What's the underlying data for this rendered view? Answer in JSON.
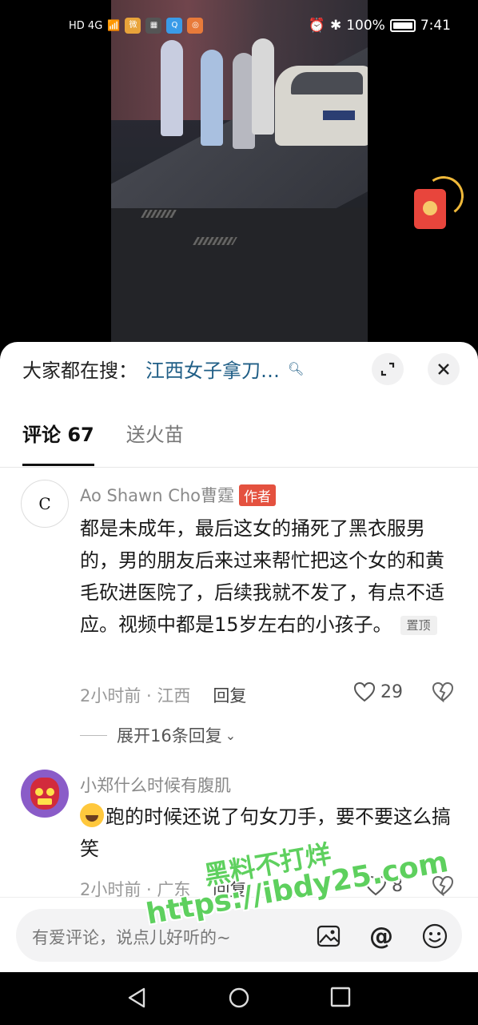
{
  "status_bar": {
    "network": "HD 4G",
    "battery_percent": "100%",
    "time": "7:41"
  },
  "search": {
    "label": "大家都在搜：",
    "query": "江西女子拿刀…"
  },
  "tabs": [
    {
      "label": "评论 67",
      "active": true
    },
    {
      "label": "送火苗",
      "active": false
    }
  ],
  "comments": [
    {
      "username": "Ao Shawn Cho曹霆",
      "badge": "作者",
      "text": "都是未成年，最后这女的捅死了黑衣服男的，男的朋友后来过来帮忙把这个女的和黄毛砍进医院了，后续我就不发了，有点不适应。视频中都是15岁左右的小孩子。",
      "pin": "置顶",
      "meta": "2小时前 · 江西",
      "reply": "回复",
      "likes": "29",
      "expand": "展开16条回复"
    },
    {
      "username": "小郑什么时候有腹肌",
      "text": "跑的时候还说了句女刀手，要不要这么搞笑",
      "meta": "2小时前 · 广东",
      "reply": "回复",
      "likes": "8"
    }
  ],
  "input": {
    "placeholder": "有爱评论，说点儿好听的~"
  },
  "watermark": {
    "line1": "黑料不打烊",
    "line2": "https://ibdy25.com"
  },
  "icons": {
    "expand": "expand-icon",
    "close": "close-icon",
    "image": "image-icon",
    "mention": "at-icon",
    "emoji": "emoji-icon",
    "back": "back-icon",
    "home": "home-icon",
    "recents": "recents-icon"
  },
  "colors": {
    "accent_link": "#1f5e86",
    "author_badge": "#e4513f",
    "watermark": "#5ed05e"
  }
}
